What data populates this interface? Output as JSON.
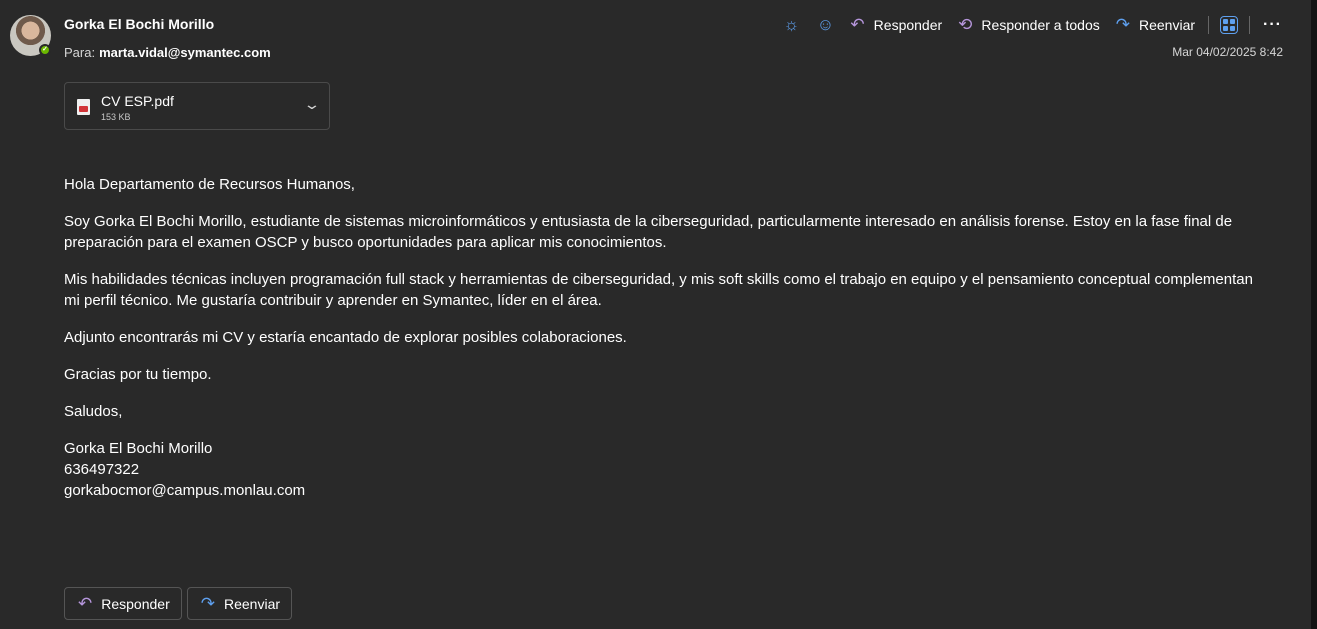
{
  "email": {
    "sender": "Gorka El Bochi Morillo",
    "to_label": "Para:",
    "to_address": "marta.vidal@symantec.com",
    "datetime": "Mar 04/02/2025 8:42",
    "presence": "available"
  },
  "toolbar": {
    "reply": "Responder",
    "reply_all": "Responder a todos",
    "forward": "Reenviar",
    "more": "···"
  },
  "attachment": {
    "name": "CV ESP.pdf",
    "size": "153 KB"
  },
  "body": {
    "greeting": "Hola Departamento de Recursos Humanos,",
    "paragraphs": [
      "Soy Gorka El Bochi Morillo, estudiante de sistemas microinformáticos y entusiasta de la ciberseguridad, particularmente interesado en análisis forense. Estoy en la fase final de preparación para el examen OSCP y busco oportunidades para aplicar mis conocimientos.",
      "Mis habilidades técnicas incluyen programación full stack y herramientas de ciberseguridad, y mis soft skills como el trabajo en equipo y el pensamiento conceptual complementan mi perfil técnico. Me gustaría contribuir y aprender en Symantec, líder en el área.",
      "Adjunto encontrarás mi CV y estaría encantado de explorar posibles colaboraciones.",
      "Gracias por tu tiempo."
    ],
    "closing": "Saludos,",
    "signature": {
      "name": "Gorka El Bochi Morillo",
      "phone": "636497322",
      "email": "gorkabocmor@campus.monlau.com"
    }
  },
  "footer": {
    "reply": "Responder",
    "forward": "Reenviar"
  },
  "colors": {
    "background": "#292929",
    "accent_blue": "#5ea0ef",
    "reply_purple": "#b696dc",
    "presence_green": "#6bb700"
  }
}
